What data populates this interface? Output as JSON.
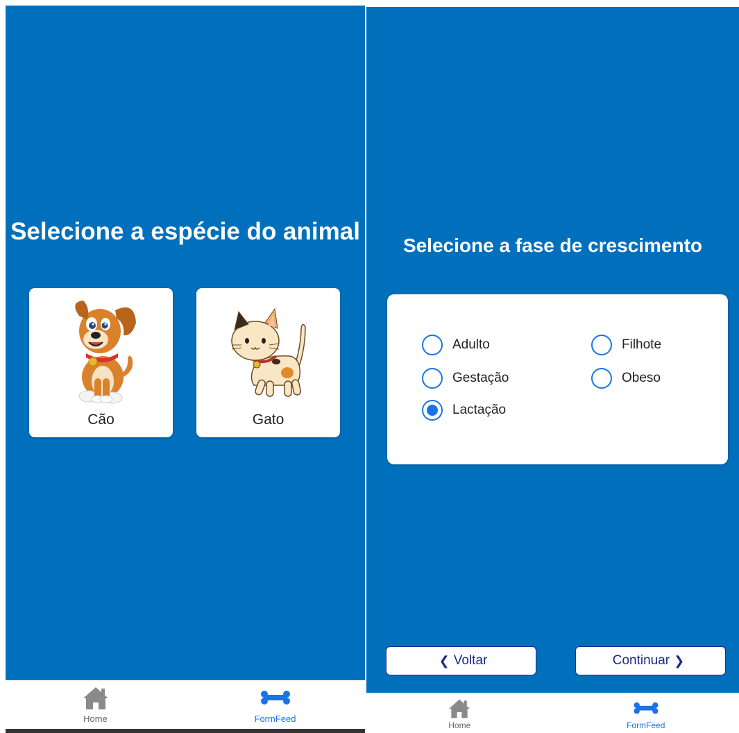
{
  "left_screen": {
    "title": "Selecione a espécie do animal",
    "cards": [
      {
        "label": "Cão",
        "image": "dog-illustration"
      },
      {
        "label": "Gato",
        "image": "cat-illustration"
      }
    ]
  },
  "right_screen": {
    "title": "Selecione a fase de crescimento",
    "options": [
      {
        "label": "Adulto",
        "checked": false
      },
      {
        "label": "Filhote",
        "checked": false
      },
      {
        "label": "Gestação",
        "checked": false
      },
      {
        "label": "Obeso",
        "checked": false
      },
      {
        "label": "Lactação",
        "checked": true
      }
    ],
    "back_label": "Voltar",
    "continue_label": "Continuar"
  },
  "tabbar": {
    "home_label": "Home",
    "formfeed_label": "FormFeed",
    "active_tab": "FormFeed"
  },
  "colors": {
    "background_blue": "#0070bd",
    "accent": "#1a73e8",
    "button_text": "#1a2a8a"
  }
}
